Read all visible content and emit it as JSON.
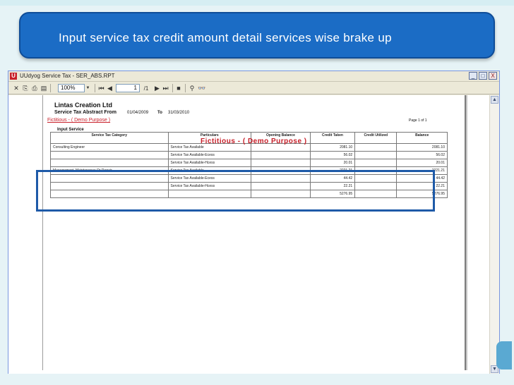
{
  "slide": {
    "title": "Input service tax credit amount detail services wise brake up"
  },
  "window": {
    "title": "UUdyog Service Tax - SER_ABS.RPT",
    "controls": [
      "_",
      "□",
      "X"
    ]
  },
  "toolbar": {
    "zoom_value": "100%",
    "page_value": "1",
    "page_total": "/1"
  },
  "report": {
    "company": "Lintas Creation Ltd",
    "heading": "Service Tax Abstract From",
    "from_date": "01/04/2009",
    "to_label": "To",
    "to_date": "31/03/2010",
    "demo_note": "Fictitious - ( Demo Purpose )",
    "page_info": "Page 1 of 1",
    "section": "Input Service",
    "watermark": "Fictitious - ( Demo Purpose )",
    "columns": [
      "Service Tax Category",
      "Particulars",
      "Opening Balance",
      "Credit Taken",
      "Credit Utilized",
      "Balance"
    ],
    "rows": [
      {
        "category": "Consulting Engineer",
        "particular": "Service Tax Available",
        "opening": "",
        "taken": "2081.10",
        "utilized": "",
        "balance": "2081.10"
      },
      {
        "category": "",
        "particular": "Service Tax Available-Ecess",
        "opening": "",
        "taken": "56.02",
        "utilized": "",
        "balance": "56.02"
      },
      {
        "category": "",
        "particular": "Service Tax Available-Hcess",
        "opening": "",
        "taken": "20.01",
        "utilized": "",
        "balance": "20.01"
      },
      {
        "category": "Management, Maintenance Or Repair",
        "particular": "Service Tax Available",
        "opening": "",
        "taken": "2221.21",
        "utilized": "",
        "balance": "2221.21"
      },
      {
        "category": "",
        "particular": "Service Tax Available-Ecess",
        "opening": "",
        "taken": "44.42",
        "utilized": "",
        "balance": "44.42"
      },
      {
        "category": "",
        "particular": "Service Tax Available-Hcess",
        "opening": "",
        "taken": "22.21",
        "utilized": "",
        "balance": "22.21"
      }
    ],
    "total_taken": "5276.95",
    "total_balance": "5276.95"
  }
}
